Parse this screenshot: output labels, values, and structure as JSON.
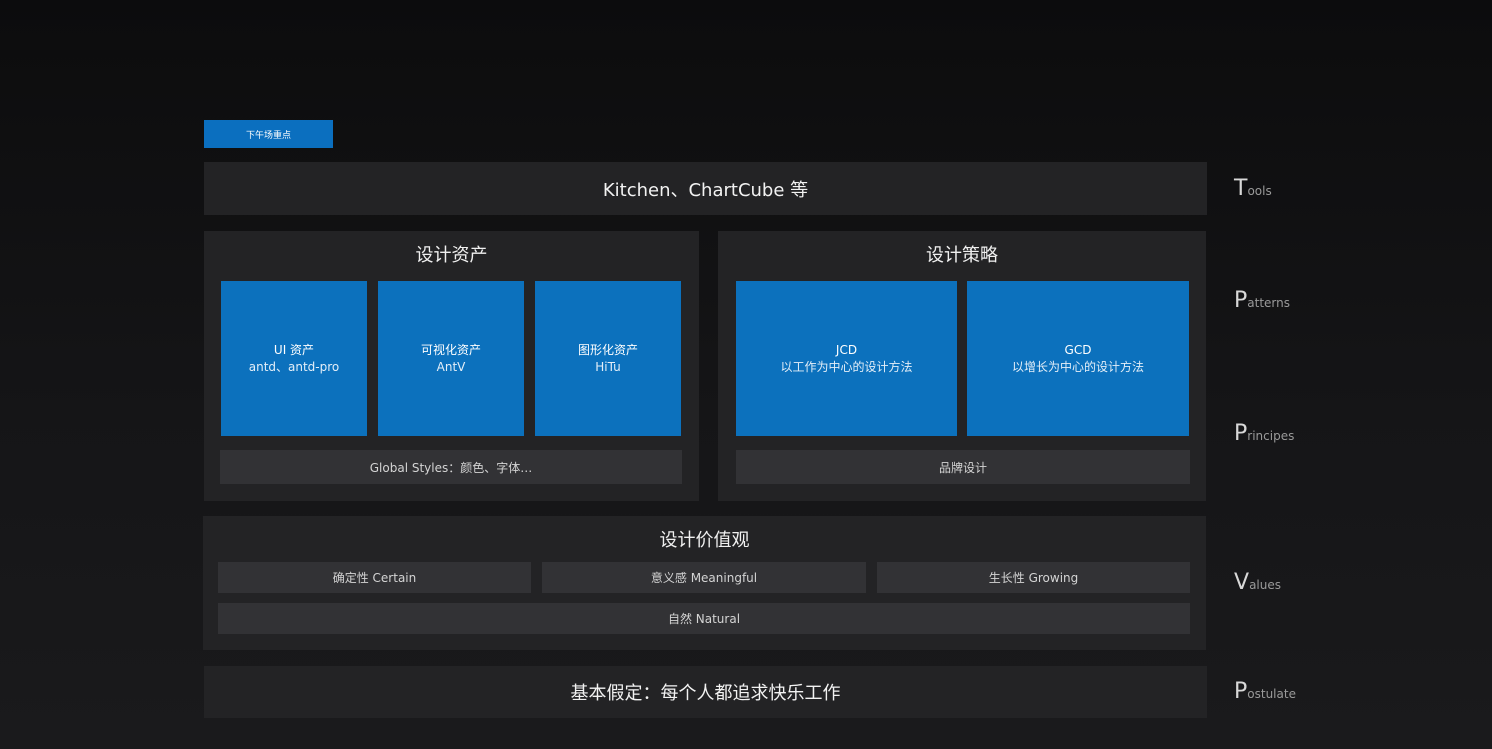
{
  "tag": "下午场重点",
  "tools_bar": "Kitchen、ChartCube 等",
  "assets": {
    "title": "设计资产",
    "cards": [
      {
        "title": "UI 资产",
        "sub": "antd、antd-pro"
      },
      {
        "title": "可视化资产",
        "sub": "AntV"
      },
      {
        "title": "图形化资产",
        "sub": "HiTu"
      }
    ],
    "footer": "Global Styles：颜色、字体…"
  },
  "strategy": {
    "title": "设计策略",
    "cards": [
      {
        "title": "JCD",
        "sub": "以工作为中心的设计方法"
      },
      {
        "title": "GCD",
        "sub": "以增长为中心的设计方法"
      }
    ],
    "footer": "品牌设计"
  },
  "values": {
    "title": "设计价值观",
    "items": [
      "确定性 Certain",
      "意义感 Meaningful",
      "生长性 Growing"
    ],
    "bottom": "自然 Natural"
  },
  "postulate": "基本假定：每个人都追求快乐工作",
  "side_labels": [
    {
      "initial": "T",
      "rest": "ools"
    },
    {
      "initial": "P",
      "rest": "atterns"
    },
    {
      "initial": "P",
      "rest": "rincipes"
    },
    {
      "initial": "V",
      "rest": "alues"
    },
    {
      "initial": "P",
      "rest": "ostulate"
    }
  ],
  "colors": {
    "accent_blue": "#0c71bd",
    "panel": "#232325",
    "bar": "#323235"
  }
}
